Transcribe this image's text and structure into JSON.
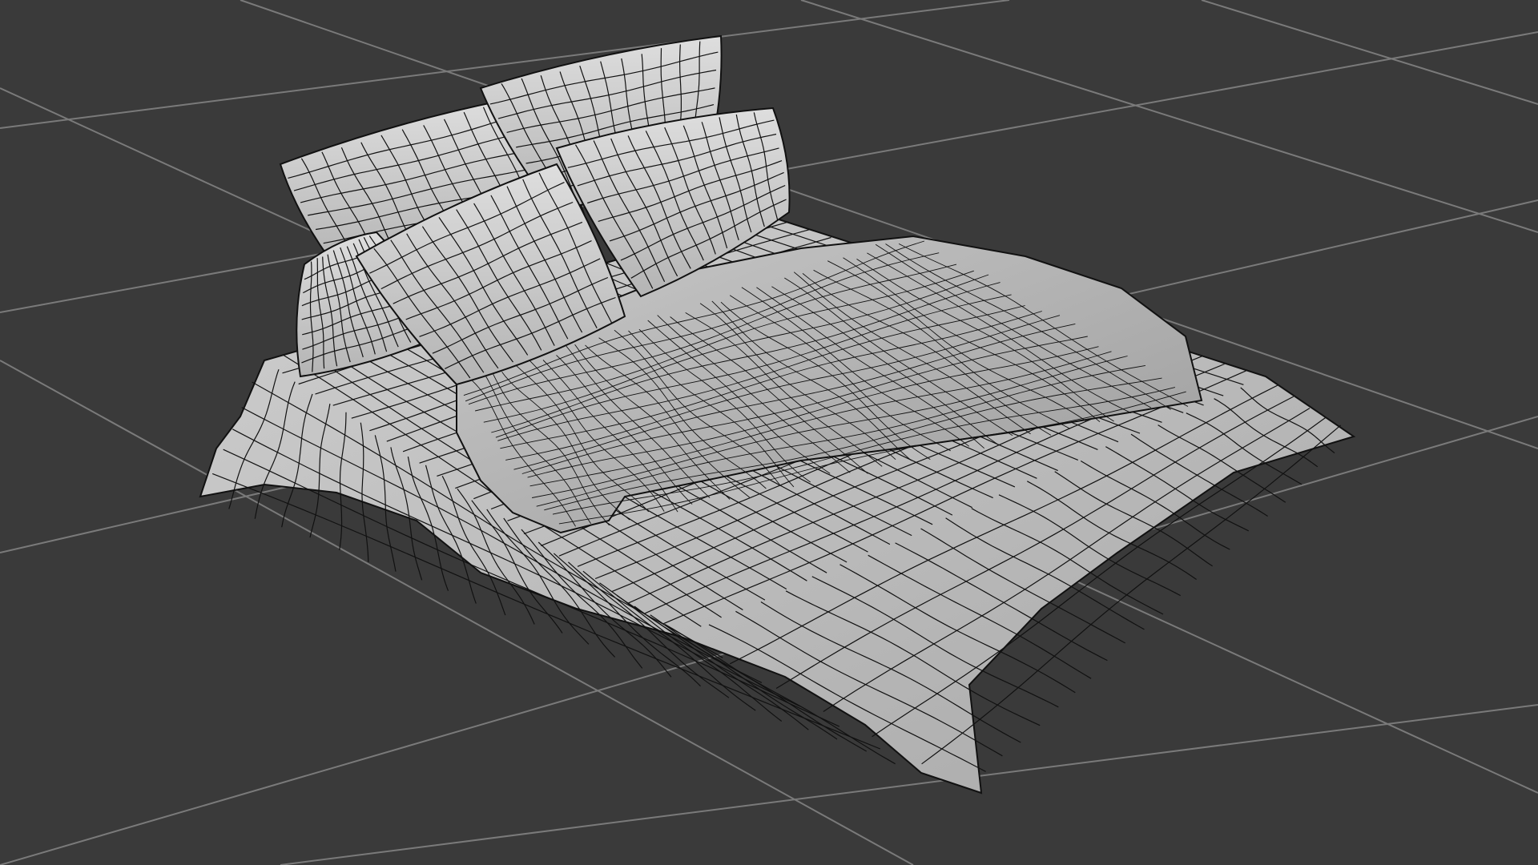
{
  "viewport": {
    "background_color": "#3a3a3a",
    "grid_line_color": "#7a7a7a",
    "mesh_fill_color": "#c2c2c2",
    "mesh_shadow_color": "#9a9a9a",
    "wire_color": "#111111"
  },
  "scene": {
    "object": "bed-with-pillows-and-duvet",
    "display_mode": "shaded-with-wireframe",
    "pillow_count": 5
  }
}
